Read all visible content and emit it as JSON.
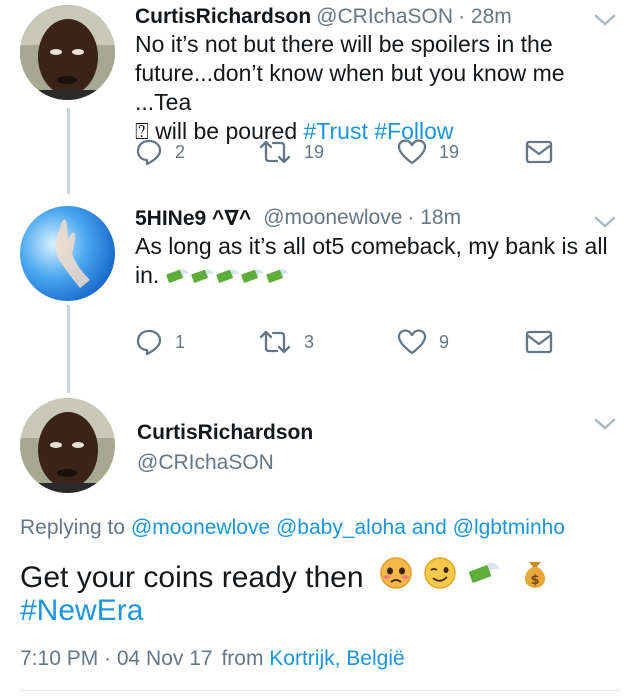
{
  "tweets": [
    {
      "display_name": "CurtisRichardson",
      "handle": "@CRIchaSON",
      "time": "· 28m",
      "text_line1": "No it’s not but there will be spoilers in the",
      "text_line2": "future...don’t know when but you know me ...Tea",
      "text_line3a": "⍰ will be poured",
      "hashtag1": "#Trust",
      "hashtag2": "#Follow",
      "replies": "2",
      "retweets": "19",
      "likes": "19"
    },
    {
      "display_name": "5HINe9 ^∇^",
      "handle": "@moonewlove",
      "time": "· 18m",
      "text_line1": "As long as it’s all ot5 comeback, my bank is all",
      "text_line2": "in.",
      "replies": "1",
      "retweets": "3",
      "likes": "9"
    }
  ],
  "focused": {
    "display_name": "CurtisRichardson",
    "handle": "@CRIchaSON",
    "replying_prefix": "Replying to",
    "replying_users": [
      "@moonewlove",
      "@baby_aloha",
      "@lgbtminho"
    ],
    "replying_and": "and",
    "text": "Get your coins ready then",
    "hashtag": "#NewEra",
    "timestamp": "7:10 PM · 04 Nov 17",
    "from_label": "from",
    "location": "Kortrijk, België"
  },
  "colors": {
    "link": "#1b95e0",
    "secondary": "#657786",
    "thread_line": "#ccd6dd"
  },
  "icons": [
    "reply-icon",
    "retweet-icon",
    "like-icon",
    "dm-icon",
    "chevron-down-icon",
    "money-with-wings-emoji",
    "money-bag-emoji",
    "pleading-face-emoji",
    "winking-face-emoji"
  ]
}
